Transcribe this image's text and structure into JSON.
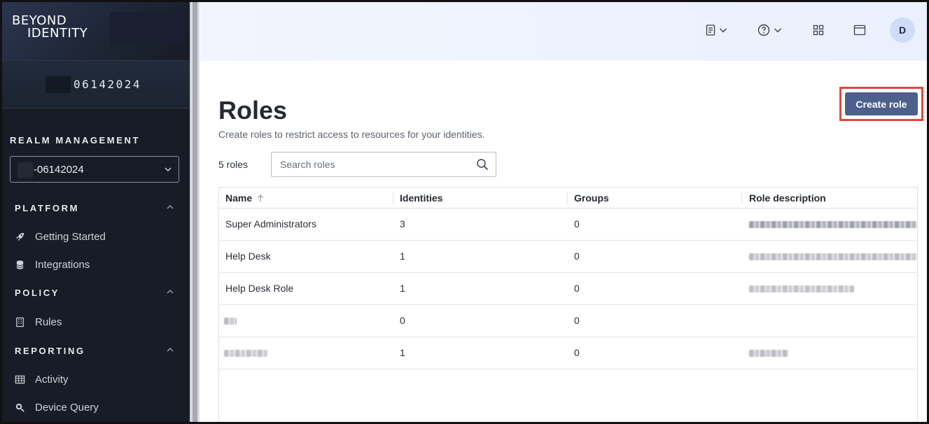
{
  "brand": {
    "line1": "BEYOND",
    "line2": "IDENTITY"
  },
  "tenant": {
    "id": "06142024"
  },
  "sidebar": {
    "realm_section": "REALM MANAGEMENT",
    "realm_value": "-06142024",
    "groups": [
      {
        "title": "PLATFORM",
        "items": [
          {
            "label": "Getting Started",
            "icon": "rocket-icon"
          },
          {
            "label": "Integrations",
            "icon": "database-icon"
          }
        ]
      },
      {
        "title": "POLICY",
        "items": [
          {
            "label": "Rules",
            "icon": "building-icon"
          }
        ]
      },
      {
        "title": "REPORTING",
        "items": [
          {
            "label": "Activity",
            "icon": "table-grid-icon"
          },
          {
            "label": "Device Query",
            "icon": "search-icon"
          }
        ]
      }
    ]
  },
  "topbar": {
    "avatar_initial": "D",
    "icons": [
      "document-icon",
      "help-icon",
      "apps-grid-icon",
      "window-icon"
    ]
  },
  "page": {
    "title": "Roles",
    "subtitle": "Create roles to restrict access to resources for your identities.",
    "create_label": "Create role",
    "count": "5 roles",
    "search_placeholder": "Search roles"
  },
  "table": {
    "columns": [
      "Name",
      "Identities",
      "Groups",
      "Role description"
    ],
    "rows": [
      {
        "name": "Super Administrators",
        "identities": "3",
        "groups": "0"
      },
      {
        "name": "Help Desk",
        "identities": "1",
        "groups": "0"
      },
      {
        "name": "Help Desk Role",
        "identities": "1",
        "groups": "0"
      },
      {
        "name": "",
        "identities": "0",
        "groups": "0"
      },
      {
        "name": "",
        "identities": "1",
        "groups": "0"
      }
    ]
  },
  "colors": {
    "sidebar_bg": "#171c26",
    "accent_button": "#4d5f8c",
    "highlight_border": "#e0473d",
    "topbar_bg": "#eef2fd"
  }
}
